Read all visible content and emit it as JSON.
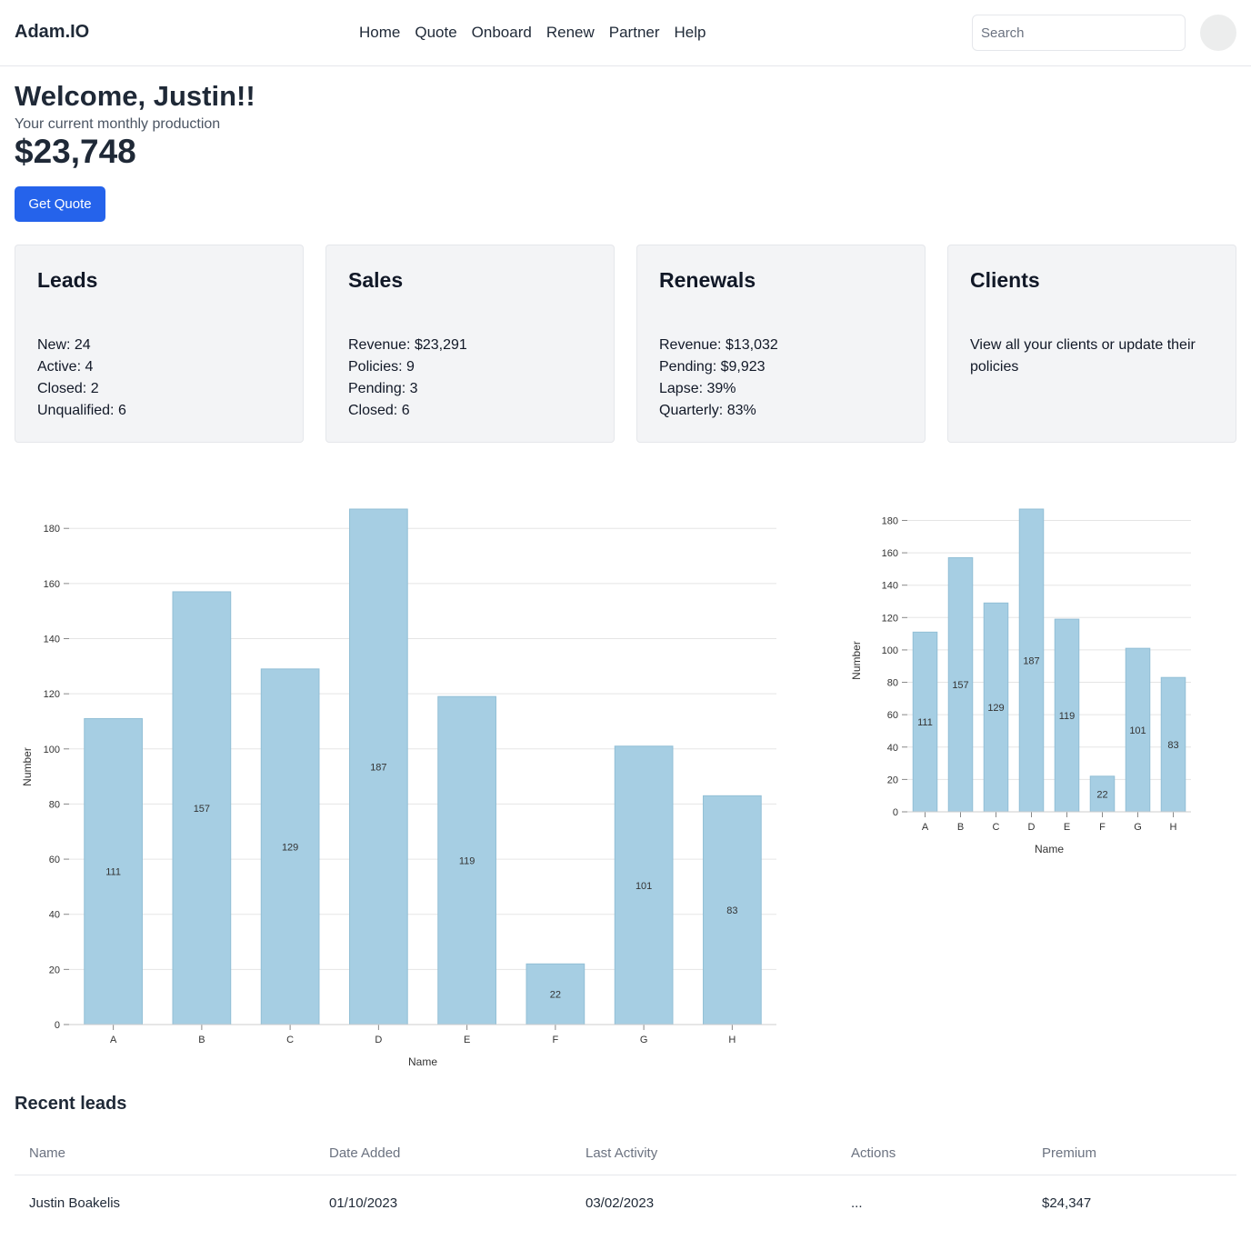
{
  "header": {
    "brand": "Adam.IO",
    "nav": [
      "Home",
      "Quote",
      "Onboard",
      "Renew",
      "Partner",
      "Help"
    ],
    "search_placeholder": "Search"
  },
  "welcome": {
    "greeting": "Welcome, Justin!!",
    "subtitle": "Your current monthly production",
    "production": "$23,748",
    "cta_label": "Get Quote"
  },
  "cards": [
    {
      "title": "Leads",
      "lines": [
        "New: 24",
        "Active: 4",
        "Closed: 2",
        "Unqualified: 6"
      ]
    },
    {
      "title": "Sales",
      "lines": [
        "Revenue: $23,291",
        "Policies: 9",
        "Pending: 3",
        "Closed: 6"
      ]
    },
    {
      "title": "Renewals",
      "lines": [
        "Revenue: $13,032",
        "Pending: $9,923",
        "Lapse: 39%",
        "Quarterly: 83%"
      ]
    },
    {
      "title": "Clients",
      "lines": [
        "View all your clients or update their policies"
      ]
    }
  ],
  "chart_data": [
    {
      "type": "bar",
      "categories": [
        "A",
        "B",
        "C",
        "D",
        "E",
        "F",
        "G",
        "H"
      ],
      "values": [
        111,
        157,
        129,
        187,
        119,
        22,
        101,
        83
      ],
      "xlabel": "Name",
      "ylabel": "Number",
      "ylim": [
        0,
        187
      ],
      "yticks": [
        0,
        20,
        40,
        60,
        80,
        100,
        120,
        140,
        160,
        180
      ],
      "grid": true,
      "data_labels": true,
      "bar_color": "#a6cee3"
    },
    {
      "type": "bar",
      "categories": [
        "A",
        "B",
        "C",
        "D",
        "E",
        "F",
        "G",
        "H"
      ],
      "values": [
        111,
        157,
        129,
        187,
        119,
        22,
        101,
        83
      ],
      "xlabel": "Name",
      "ylabel": "Number",
      "ylim": [
        0,
        187
      ],
      "yticks": [
        0,
        20,
        40,
        60,
        80,
        100,
        120,
        140,
        160,
        180
      ],
      "grid": true,
      "data_labels": true,
      "bar_color": "#a6cee3"
    }
  ],
  "recent_leads": {
    "title": "Recent leads",
    "columns": [
      "Name",
      "Date Added",
      "Last Activity",
      "Actions",
      "Premium"
    ],
    "rows": [
      [
        "Justin Boakelis",
        "01/10/2023",
        "03/02/2023",
        "...",
        "$24,347"
      ]
    ]
  },
  "colors": {
    "accent": "#2563eb",
    "bar": "#a6cee3",
    "card_bg": "#f3f4f6"
  }
}
